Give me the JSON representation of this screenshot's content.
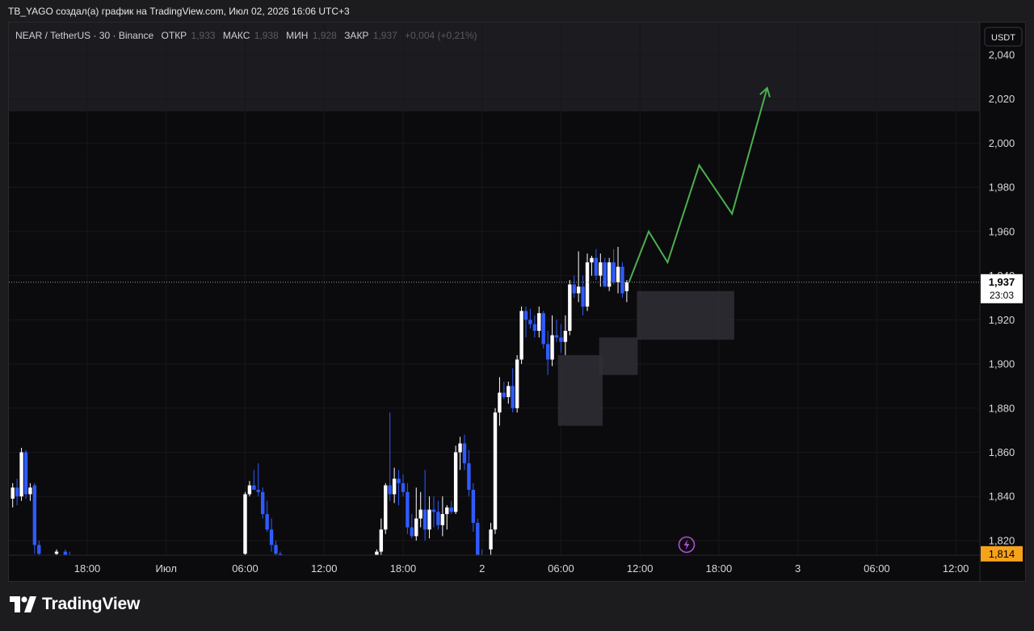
{
  "header": {
    "title": "TB_YAGO создал(а) график на TradingView.com, Июл 02, 2026 16:06 UTC+3"
  },
  "legend": {
    "symbol": "NEAR / TetherUS · 30 · Binance",
    "open_label": "ОТКР",
    "open_value": "1,933",
    "high_label": "МАКС",
    "high_value": "1,938",
    "low_label": "МИН",
    "low_value": "1,928",
    "close_label": "ЗАКР",
    "close_value": "1,937",
    "change": "+0,004 (+0,21%)"
  },
  "currency_badge": "USDT",
  "price_labels": {
    "current": "1,937",
    "countdown": "23:03",
    "low_marker": "1,814"
  },
  "footer": {
    "brand": "TradingView"
  },
  "colors": {
    "up": "#ffffff",
    "down": "#2f5bff",
    "projection": "#4caf50",
    "zone": "#2f2f35",
    "low_marker": "#f7a21b",
    "alert_icon": "#b44dd6"
  },
  "chart_data": {
    "type": "candlestick",
    "y_axis": {
      "ylim": [
        1.8134,
        2.0546
      ],
      "tick_labels": [
        "2,040",
        "2,020",
        "2,000",
        "1,980",
        "1,960",
        "1,940",
        "1,920",
        "1,900",
        "1,880",
        "1,860",
        "1,840",
        "1,820"
      ],
      "tick_values": [
        2.04,
        2.02,
        2.0,
        1.98,
        1.96,
        1.94,
        1.92,
        1.9,
        1.88,
        1.86,
        1.84,
        1.82
      ]
    },
    "x_axis": {
      "tick_labels": [
        "18:00",
        "Июл",
        "06:00",
        "12:00",
        "18:00",
        "2",
        "06:00",
        "12:00",
        "18:00",
        "3",
        "06:00",
        "12:00"
      ],
      "tick_index": [
        18,
        36,
        54,
        72,
        90,
        108,
        126,
        144,
        162,
        180,
        198,
        216
      ]
    },
    "grid": true,
    "candles": [
      [
        1,
        1.839,
        1.846,
        1.835,
        1.844
      ],
      [
        2,
        1.844,
        1.848,
        1.836,
        1.84
      ],
      [
        3,
        1.84,
        1.862,
        1.838,
        1.86
      ],
      [
        4,
        1.86,
        1.861,
        1.839,
        1.841
      ],
      [
        5,
        1.841,
        1.846,
        1.838,
        1.844
      ],
      [
        6,
        1.845,
        1.846,
        1.814,
        1.818
      ],
      [
        7,
        1.818,
        1.82,
        1.812,
        1.814
      ],
      [
        11,
        1.814,
        1.816,
        1.812,
        1.815
      ],
      [
        13,
        1.815,
        1.816,
        1.812,
        1.813
      ],
      [
        14,
        1.813,
        1.815,
        1.811,
        1.812
      ],
      [
        54,
        1.814,
        1.842,
        1.812,
        1.841
      ],
      [
        55,
        1.841,
        1.847,
        1.84,
        1.845
      ],
      [
        56,
        1.845,
        1.852,
        1.843,
        1.843
      ],
      [
        57,
        1.843,
        1.855,
        1.84,
        1.842
      ],
      [
        58,
        1.842,
        1.844,
        1.83,
        1.832
      ],
      [
        59,
        1.832,
        1.838,
        1.824,
        1.825
      ],
      [
        60,
        1.825,
        1.83,
        1.815,
        1.818
      ],
      [
        61,
        1.818,
        1.82,
        1.813,
        1.814
      ],
      [
        62,
        1.814,
        1.815,
        1.81,
        1.811
      ],
      [
        84,
        1.81,
        1.816,
        1.808,
        1.815
      ],
      [
        85,
        1.815,
        1.83,
        1.813,
        1.825
      ],
      [
        86,
        1.825,
        1.846,
        1.823,
        1.845
      ],
      [
        87,
        1.845,
        1.878,
        1.838,
        1.841
      ],
      [
        88,
        1.841,
        1.853,
        1.837,
        1.848
      ],
      [
        89,
        1.848,
        1.852,
        1.836,
        1.846
      ],
      [
        90,
        1.846,
        1.85,
        1.84,
        1.842
      ],
      [
        91,
        1.842,
        1.846,
        1.823,
        1.826
      ],
      [
        92,
        1.826,
        1.832,
        1.821,
        1.822
      ],
      [
        93,
        1.822,
        1.844,
        1.82,
        1.83
      ],
      [
        94,
        1.83,
        1.842,
        1.826,
        1.834
      ],
      [
        95,
        1.834,
        1.852,
        1.82,
        1.825
      ],
      [
        96,
        1.825,
        1.84,
        1.821,
        1.834
      ],
      [
        97,
        1.834,
        1.84,
        1.826,
        1.833
      ],
      [
        98,
        1.833,
        1.838,
        1.825,
        1.827
      ],
      [
        99,
        1.827,
        1.84,
        1.822,
        1.832
      ],
      [
        100,
        1.832,
        1.836,
        1.825,
        1.835
      ],
      [
        101,
        1.835,
        1.838,
        1.832,
        1.833
      ],
      [
        102,
        1.833,
        1.863,
        1.832,
        1.86
      ],
      [
        103,
        1.86,
        1.867,
        1.852,
        1.864
      ],
      [
        104,
        1.864,
        1.868,
        1.852,
        1.855
      ],
      [
        105,
        1.855,
        1.861,
        1.84,
        1.843
      ],
      [
        106,
        1.843,
        1.846,
        1.824,
        1.828
      ],
      [
        107,
        1.828,
        1.83,
        1.81,
        1.813
      ],
      [
        108,
        1.813,
        1.816,
        1.808,
        1.811
      ],
      [
        110,
        1.816,
        1.828,
        1.812,
        1.825
      ],
      [
        111,
        1.825,
        1.88,
        1.823,
        1.878
      ],
      [
        112,
        1.878,
        1.894,
        1.872,
        1.887
      ],
      [
        113,
        1.887,
        1.892,
        1.884,
        1.885
      ],
      [
        114,
        1.885,
        1.892,
        1.882,
        1.89
      ],
      [
        115,
        1.89,
        1.898,
        1.878,
        1.88
      ],
      [
        116,
        1.88,
        1.904,
        1.878,
        1.902
      ],
      [
        117,
        1.902,
        1.926,
        1.9,
        1.924
      ],
      [
        118,
        1.924,
        1.926,
        1.912,
        1.92
      ],
      [
        119,
        1.92,
        1.925,
        1.916,
        1.918
      ],
      [
        120,
        1.918,
        1.922,
        1.912,
        1.915
      ],
      [
        121,
        1.915,
        1.926,
        1.912,
        1.923
      ],
      [
        122,
        1.923,
        1.924,
        1.907,
        1.909
      ],
      [
        123,
        1.909,
        1.915,
        1.895,
        1.902
      ],
      [
        124,
        1.902,
        1.922,
        1.899,
        1.913
      ],
      [
        125,
        1.913,
        1.92,
        1.91,
        1.912
      ],
      [
        126,
        1.912,
        1.918,
        1.905,
        1.91
      ],
      [
        127,
        1.91,
        1.922,
        1.904,
        1.915
      ],
      [
        128,
        1.915,
        1.938,
        1.913,
        1.936
      ],
      [
        129,
        1.936,
        1.94,
        1.93,
        1.932
      ],
      [
        130,
        1.932,
        1.951,
        1.928,
        1.935
      ],
      [
        131,
        1.935,
        1.94,
        1.922,
        1.926
      ],
      [
        132,
        1.926,
        1.95,
        1.924,
        1.946
      ],
      [
        133,
        1.946,
        1.949,
        1.94,
        1.948
      ],
      [
        134,
        1.948,
        1.952,
        1.938,
        1.94
      ],
      [
        135,
        1.94,
        1.95,
        1.935,
        1.946
      ],
      [
        136,
        1.946,
        1.948,
        1.936,
        1.935
      ],
      [
        137,
        1.935,
        1.948,
        1.933,
        1.946
      ],
      [
        138,
        1.946,
        1.952,
        1.936,
        1.937
      ],
      [
        139,
        1.937,
        1.953,
        1.932,
        1.944
      ],
      [
        140,
        1.944,
        1.946,
        1.93,
        1.932
      ],
      [
        141,
        1.933,
        1.938,
        1.928,
        1.937
      ]
    ],
    "zones": [
      {
        "x0": 125.3,
        "x1": 135.5,
        "y0": 1.872,
        "y1": 1.904
      },
      {
        "x0": 134.7,
        "x1": 143.5,
        "y0": 1.895,
        "y1": 1.912
      },
      {
        "x0": 143.3,
        "x1": 165.5,
        "y0": 1.911,
        "y1": 1.933
      }
    ],
    "projection": [
      [
        141.5,
        1.937
      ],
      [
        146.0,
        1.96
      ],
      [
        150.3,
        1.946
      ],
      [
        157.5,
        1.99
      ],
      [
        165.0,
        1.968
      ],
      [
        173.0,
        2.025
      ]
    ],
    "current_price": 1.937,
    "low_marker_price": 1.814
  }
}
